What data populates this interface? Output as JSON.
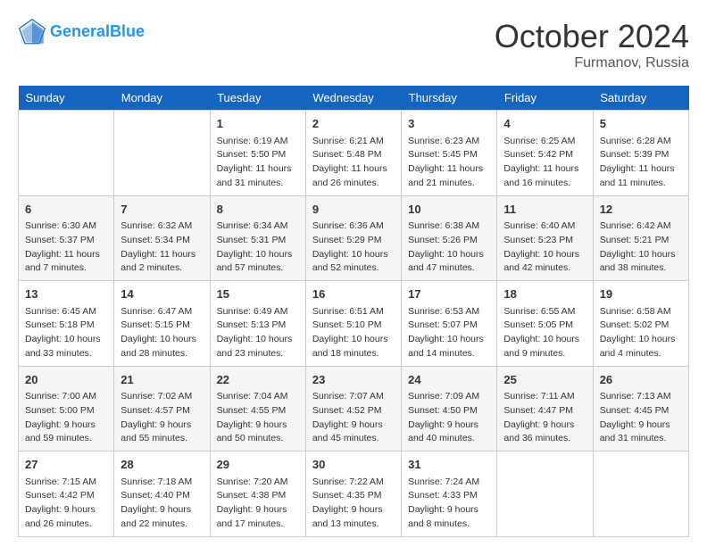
{
  "header": {
    "logo_line1": "General",
    "logo_line2": "Blue",
    "month": "October 2024",
    "location": "Furmanov, Russia"
  },
  "days_of_week": [
    "Sunday",
    "Monday",
    "Tuesday",
    "Wednesday",
    "Thursday",
    "Friday",
    "Saturday"
  ],
  "weeks": [
    [
      {
        "day": "",
        "sunrise": "",
        "sunset": "",
        "daylight": ""
      },
      {
        "day": "",
        "sunrise": "",
        "sunset": "",
        "daylight": ""
      },
      {
        "day": "1",
        "sunrise": "Sunrise: 6:19 AM",
        "sunset": "Sunset: 5:50 PM",
        "daylight": "Daylight: 11 hours and 31 minutes."
      },
      {
        "day": "2",
        "sunrise": "Sunrise: 6:21 AM",
        "sunset": "Sunset: 5:48 PM",
        "daylight": "Daylight: 11 hours and 26 minutes."
      },
      {
        "day": "3",
        "sunrise": "Sunrise: 6:23 AM",
        "sunset": "Sunset: 5:45 PM",
        "daylight": "Daylight: 11 hours and 21 minutes."
      },
      {
        "day": "4",
        "sunrise": "Sunrise: 6:25 AM",
        "sunset": "Sunset: 5:42 PM",
        "daylight": "Daylight: 11 hours and 16 minutes."
      },
      {
        "day": "5",
        "sunrise": "Sunrise: 6:28 AM",
        "sunset": "Sunset: 5:39 PM",
        "daylight": "Daylight: 11 hours and 11 minutes."
      }
    ],
    [
      {
        "day": "6",
        "sunrise": "Sunrise: 6:30 AM",
        "sunset": "Sunset: 5:37 PM",
        "daylight": "Daylight: 11 hours and 7 minutes."
      },
      {
        "day": "7",
        "sunrise": "Sunrise: 6:32 AM",
        "sunset": "Sunset: 5:34 PM",
        "daylight": "Daylight: 11 hours and 2 minutes."
      },
      {
        "day": "8",
        "sunrise": "Sunrise: 6:34 AM",
        "sunset": "Sunset: 5:31 PM",
        "daylight": "Daylight: 10 hours and 57 minutes."
      },
      {
        "day": "9",
        "sunrise": "Sunrise: 6:36 AM",
        "sunset": "Sunset: 5:29 PM",
        "daylight": "Daylight: 10 hours and 52 minutes."
      },
      {
        "day": "10",
        "sunrise": "Sunrise: 6:38 AM",
        "sunset": "Sunset: 5:26 PM",
        "daylight": "Daylight: 10 hours and 47 minutes."
      },
      {
        "day": "11",
        "sunrise": "Sunrise: 6:40 AM",
        "sunset": "Sunset: 5:23 PM",
        "daylight": "Daylight: 10 hours and 42 minutes."
      },
      {
        "day": "12",
        "sunrise": "Sunrise: 6:42 AM",
        "sunset": "Sunset: 5:21 PM",
        "daylight": "Daylight: 10 hours and 38 minutes."
      }
    ],
    [
      {
        "day": "13",
        "sunrise": "Sunrise: 6:45 AM",
        "sunset": "Sunset: 5:18 PM",
        "daylight": "Daylight: 10 hours and 33 minutes."
      },
      {
        "day": "14",
        "sunrise": "Sunrise: 6:47 AM",
        "sunset": "Sunset: 5:15 PM",
        "daylight": "Daylight: 10 hours and 28 minutes."
      },
      {
        "day": "15",
        "sunrise": "Sunrise: 6:49 AM",
        "sunset": "Sunset: 5:13 PM",
        "daylight": "Daylight: 10 hours and 23 minutes."
      },
      {
        "day": "16",
        "sunrise": "Sunrise: 6:51 AM",
        "sunset": "Sunset: 5:10 PM",
        "daylight": "Daylight: 10 hours and 18 minutes."
      },
      {
        "day": "17",
        "sunrise": "Sunrise: 6:53 AM",
        "sunset": "Sunset: 5:07 PM",
        "daylight": "Daylight: 10 hours and 14 minutes."
      },
      {
        "day": "18",
        "sunrise": "Sunrise: 6:55 AM",
        "sunset": "Sunset: 5:05 PM",
        "daylight": "Daylight: 10 hours and 9 minutes."
      },
      {
        "day": "19",
        "sunrise": "Sunrise: 6:58 AM",
        "sunset": "Sunset: 5:02 PM",
        "daylight": "Daylight: 10 hours and 4 minutes."
      }
    ],
    [
      {
        "day": "20",
        "sunrise": "Sunrise: 7:00 AM",
        "sunset": "Sunset: 5:00 PM",
        "daylight": "Daylight: 9 hours and 59 minutes."
      },
      {
        "day": "21",
        "sunrise": "Sunrise: 7:02 AM",
        "sunset": "Sunset: 4:57 PM",
        "daylight": "Daylight: 9 hours and 55 minutes."
      },
      {
        "day": "22",
        "sunrise": "Sunrise: 7:04 AM",
        "sunset": "Sunset: 4:55 PM",
        "daylight": "Daylight: 9 hours and 50 minutes."
      },
      {
        "day": "23",
        "sunrise": "Sunrise: 7:07 AM",
        "sunset": "Sunset: 4:52 PM",
        "daylight": "Daylight: 9 hours and 45 minutes."
      },
      {
        "day": "24",
        "sunrise": "Sunrise: 7:09 AM",
        "sunset": "Sunset: 4:50 PM",
        "daylight": "Daylight: 9 hours and 40 minutes."
      },
      {
        "day": "25",
        "sunrise": "Sunrise: 7:11 AM",
        "sunset": "Sunset: 4:47 PM",
        "daylight": "Daylight: 9 hours and 36 minutes."
      },
      {
        "day": "26",
        "sunrise": "Sunrise: 7:13 AM",
        "sunset": "Sunset: 4:45 PM",
        "daylight": "Daylight: 9 hours and 31 minutes."
      }
    ],
    [
      {
        "day": "27",
        "sunrise": "Sunrise: 7:15 AM",
        "sunset": "Sunset: 4:42 PM",
        "daylight": "Daylight: 9 hours and 26 minutes."
      },
      {
        "day": "28",
        "sunrise": "Sunrise: 7:18 AM",
        "sunset": "Sunset: 4:40 PM",
        "daylight": "Daylight: 9 hours and 22 minutes."
      },
      {
        "day": "29",
        "sunrise": "Sunrise: 7:20 AM",
        "sunset": "Sunset: 4:38 PM",
        "daylight": "Daylight: 9 hours and 17 minutes."
      },
      {
        "day": "30",
        "sunrise": "Sunrise: 7:22 AM",
        "sunset": "Sunset: 4:35 PM",
        "daylight": "Daylight: 9 hours and 13 minutes."
      },
      {
        "day": "31",
        "sunrise": "Sunrise: 7:24 AM",
        "sunset": "Sunset: 4:33 PM",
        "daylight": "Daylight: 9 hours and 8 minutes."
      },
      {
        "day": "",
        "sunrise": "",
        "sunset": "",
        "daylight": ""
      },
      {
        "day": "",
        "sunrise": "",
        "sunset": "",
        "daylight": ""
      }
    ]
  ]
}
